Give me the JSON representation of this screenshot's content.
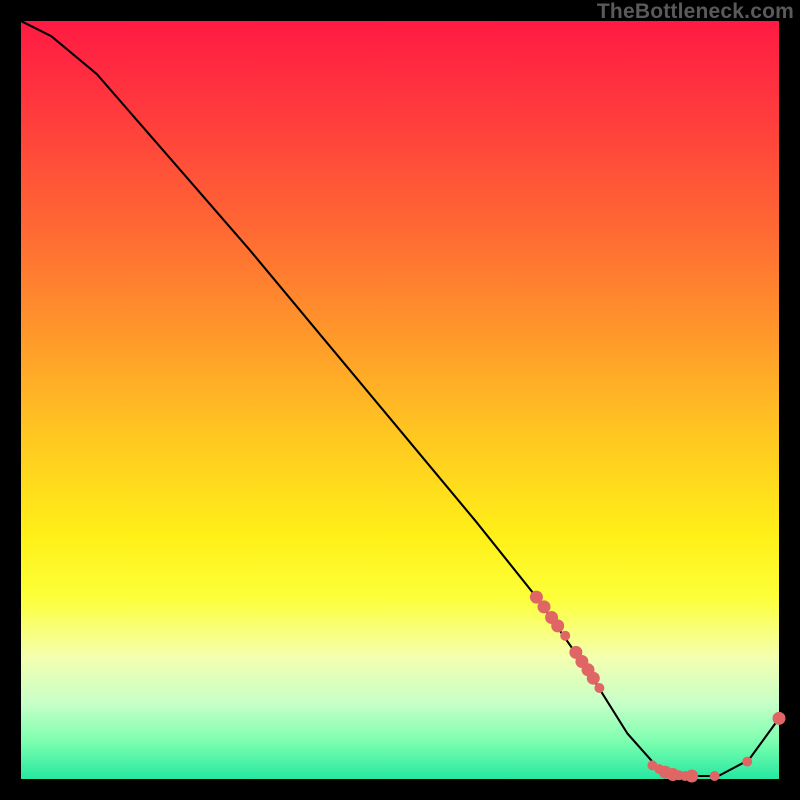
{
  "watermark": "TheBottleneck.com",
  "chart_data": {
    "type": "line",
    "title": "",
    "xlabel": "",
    "ylabel": "",
    "xlim": [
      0,
      100
    ],
    "ylim": [
      0,
      100
    ],
    "series": [
      {
        "name": "bottleneck-curve",
        "x": [
          0,
          4,
          10,
          20,
          30,
          40,
          50,
          60,
          68,
          75,
          80,
          84,
          88,
          92,
          96,
          100
        ],
        "y": [
          100,
          98,
          93,
          81.5,
          70,
          58,
          46,
          34,
          24,
          14,
          6,
          1.5,
          0.4,
          0.4,
          2.5,
          8
        ]
      }
    ],
    "markers": {
      "name": "highlight-points",
      "color": "#e06666",
      "radius_small": 5,
      "radius_large": 6.5,
      "points": [
        {
          "x": 68.0,
          "y": 24.0,
          "r": "l"
        },
        {
          "x": 69.0,
          "y": 22.7,
          "r": "l"
        },
        {
          "x": 70.0,
          "y": 21.3,
          "r": "l"
        },
        {
          "x": 70.8,
          "y": 20.2,
          "r": "l"
        },
        {
          "x": 71.8,
          "y": 18.9,
          "r": "s"
        },
        {
          "x": 73.2,
          "y": 16.7,
          "r": "l"
        },
        {
          "x": 74.0,
          "y": 15.5,
          "r": "l"
        },
        {
          "x": 74.8,
          "y": 14.4,
          "r": "l"
        },
        {
          "x": 75.5,
          "y": 13.3,
          "r": "l"
        },
        {
          "x": 76.3,
          "y": 12.0,
          "r": "s"
        },
        {
          "x": 83.3,
          "y": 1.8,
          "r": "s"
        },
        {
          "x": 84.2,
          "y": 1.3,
          "r": "s"
        },
        {
          "x": 85.0,
          "y": 0.9,
          "r": "l"
        },
        {
          "x": 86.0,
          "y": 0.6,
          "r": "l"
        },
        {
          "x": 86.8,
          "y": 0.5,
          "r": "s"
        },
        {
          "x": 87.6,
          "y": 0.4,
          "r": "s"
        },
        {
          "x": 88.5,
          "y": 0.4,
          "r": "l"
        },
        {
          "x": 91.5,
          "y": 0.4,
          "r": "s"
        },
        {
          "x": 95.8,
          "y": 2.3,
          "r": "s"
        },
        {
          "x": 100.0,
          "y": 8.0,
          "r": "l"
        }
      ]
    }
  }
}
